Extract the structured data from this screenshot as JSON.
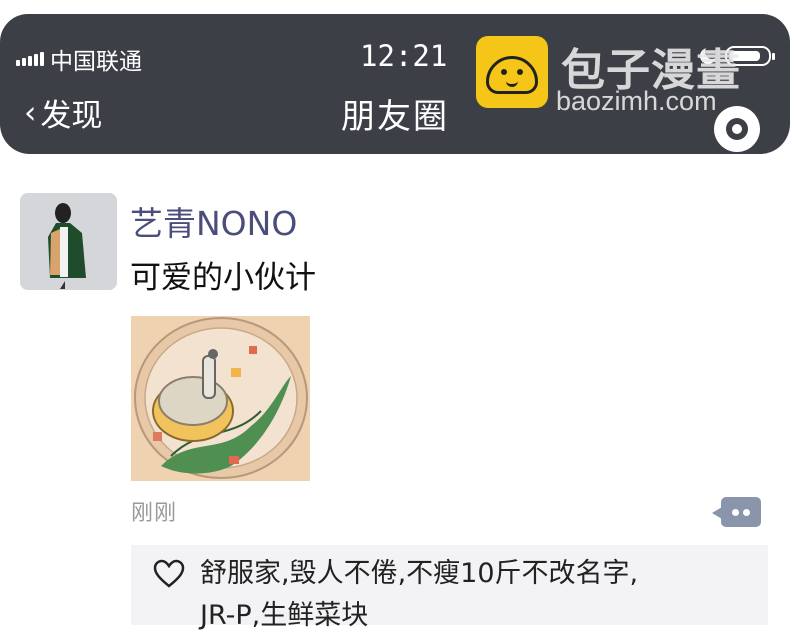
{
  "status_bar": {
    "carrier": "中国联通",
    "time": "12:21"
  },
  "nav": {
    "back_label": "发现",
    "title": "朋友圈"
  },
  "watermark": {
    "title": "包子漫畫",
    "url": "baozimh.com"
  },
  "post": {
    "username": "艺青NONO",
    "text": "可爱的小伙计",
    "timestamp": "刚刚",
    "likes_line1": "舒服家,毁人不倦,不瘦10斤不改名字,",
    "likes_line2": "JR-P,生鲜菜块"
  },
  "colors": {
    "header_bg": "#3d3f46",
    "username": "#4b4e7a",
    "comment_button": "#8a94aa",
    "watermark_logo": "#f5c518"
  },
  "icons": [
    "signal-icon",
    "moon-icon",
    "battery-icon",
    "back-chevron-icon",
    "camera-icon",
    "comment-icon",
    "heart-icon"
  ]
}
